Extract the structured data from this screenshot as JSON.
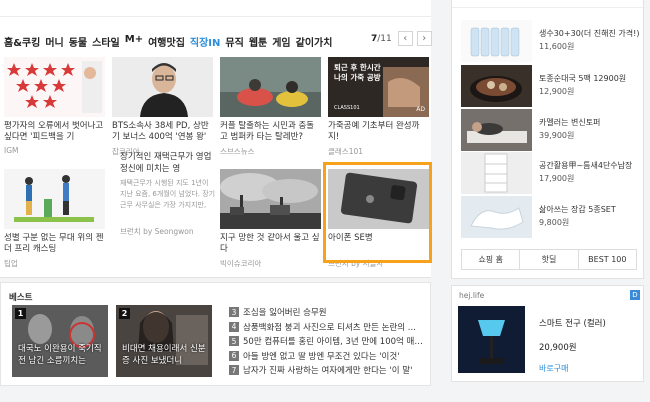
{
  "nav": {
    "categories": [
      "홈&쿠킹",
      "머니",
      "동물",
      "스타일",
      "M+",
      "여행맛집",
      "직장IN",
      "뮤직",
      "웹툰",
      "게임",
      "같이가치"
    ],
    "pager_current": "7",
    "pager_total": "/11",
    "prev_icon": "chevron-left-icon",
    "next_icon": "chevron-right-icon"
  },
  "cards": [
    {
      "title": "평가자의 오류에서 벗어나고 싶다면 '피드백을 기",
      "source": "IGM"
    },
    {
      "title": "BTS소속사 38세 PD, 상반기 보너스 400억 '연봉 왕'",
      "source": "잡코리아"
    },
    {
      "title": "커플 탈출하는 시민과 충돌고 범퍼카 타는 탈레반?",
      "source": "스브스뉴스"
    },
    {
      "title": "가죽공예 기초부터 완성까지!",
      "source": "클래스101"
    },
    {
      "title": "성별 구분 없는 무대 위의 젠더 프리 캐스팅",
      "source": "팁업"
    },
    {
      "title": "장기적인 재택근무가 영업정신에 미치는 영",
      "body": "재택근무가 시행된 지도 1년이 지난 요즘, 6개월이 넘었다. 장기 근무 사무실은 가장 가지지만,",
      "source": "브런치 by Seongwon"
    },
    {
      "title": "지구 망한 것 같아서 울고 싶다",
      "source": "빅이슈코리아"
    },
    {
      "title": "아이폰 SE병",
      "source": "브런치 by 서늘자"
    }
  ],
  "card_overlays": {
    "c4": [
      "퇴근 후 한시간",
      "나의 가죽 공방"
    ],
    "c4_logo": "CLASS101",
    "c4_ad": "AD"
  },
  "best": {
    "title": "베스트",
    "thumbs": [
      {
        "num": "1",
        "caption": "대국노 이완용이 죽기직전 남긴 소름끼치는"
      },
      {
        "num": "2",
        "caption": "비대면 채용이래서 신분증 사진 보냈더니"
      }
    ],
    "list": [
      {
        "num": "3",
        "text": "조심을 잃어버린 승무원"
      },
      {
        "num": "4",
        "text": "삼풍백화점 붕괴 사진으로 티셔츠 만든 논란의 ..."
      },
      {
        "num": "5",
        "text": "50만 컴퓨터를 홍린 아이템, 3년 만에 100억 매출 ..."
      },
      {
        "num": "6",
        "text": "아들 방엔 없고 딸 방엔 무조건 있다는 '이것'"
      },
      {
        "num": "7",
        "text": "남자가 진짜 사랑하는 여자에게만 한다는 '이 말'"
      }
    ]
  },
  "shop": {
    "items": [
      {
        "name": "생수30+30(더 진해진 가격!)",
        "price": "11,600원"
      },
      {
        "name": "토종순대국 5팩 12900원",
        "price": "12,900원"
      },
      {
        "name": "카멜러는 변신토퍼",
        "price": "39,900원"
      },
      {
        "name": "공간활용甲~틈새4단수납장",
        "price": "17,900원"
      },
      {
        "name": "삶아쓰는 장갑 5종SET",
        "price": "9,800원"
      }
    ],
    "tabs": [
      "쇼핑 홈",
      "핫딜",
      "BEST 100"
    ]
  },
  "ad": {
    "source": "hej.life",
    "badge": "D",
    "name": "스마트 전구 (컬러)",
    "price": "20,900원",
    "cta": "바로구매"
  }
}
